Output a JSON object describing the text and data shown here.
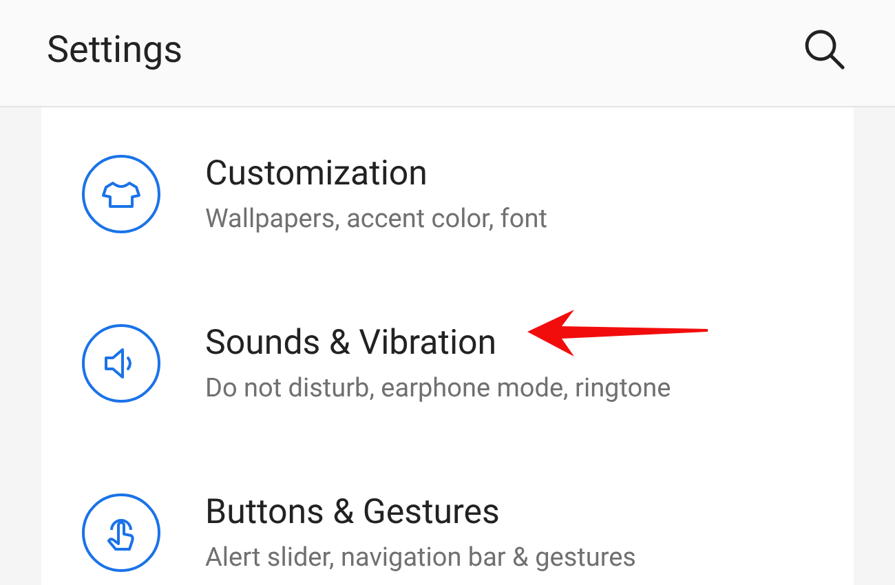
{
  "header": {
    "title": "Settings"
  },
  "items": [
    {
      "title": "Customization",
      "subtitle": "Wallpapers, accent color, font",
      "highlighted": false
    },
    {
      "title": "Sounds & Vibration",
      "subtitle": "Do not disturb, earphone mode, ringtone",
      "highlighted": true
    },
    {
      "title": "Buttons & Gestures",
      "subtitle": "Alert slider, navigation bar & gestures",
      "highlighted": false
    }
  ]
}
